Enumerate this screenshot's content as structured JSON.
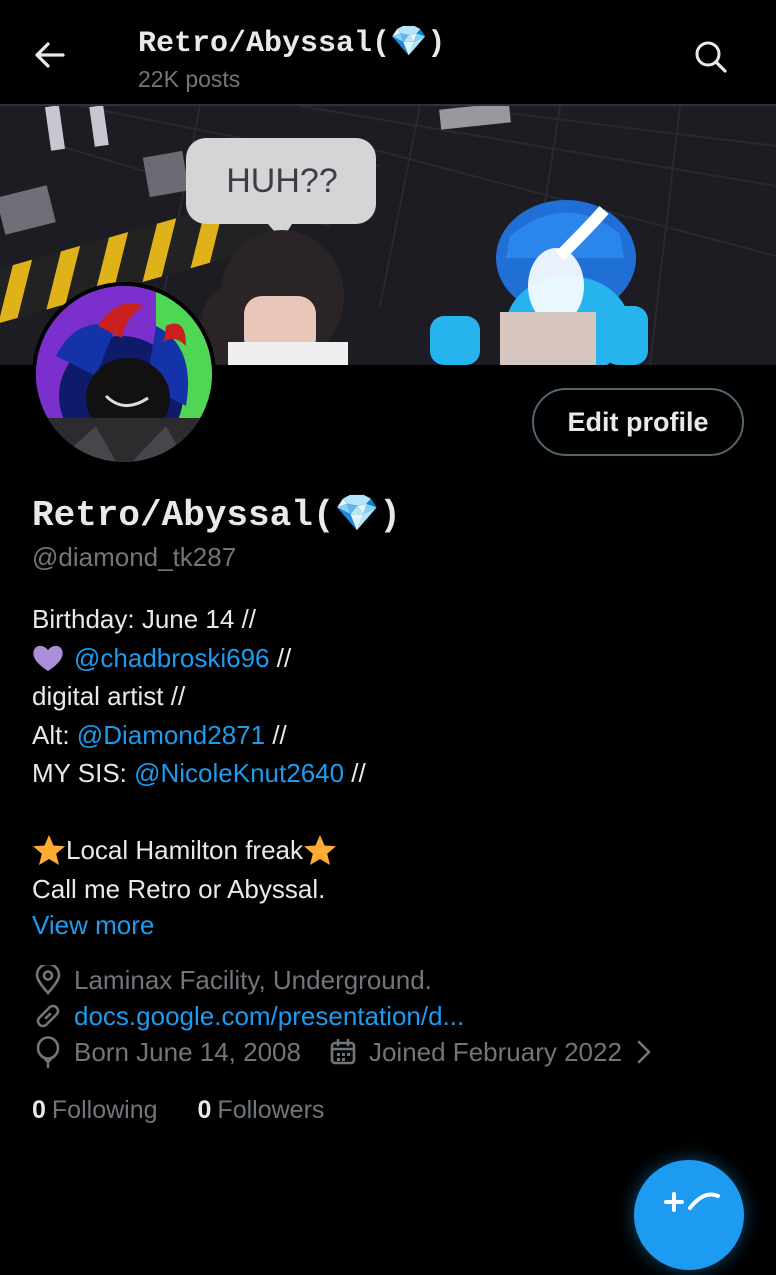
{
  "header": {
    "title": "Retro/Abyssal(💎)",
    "post_count": "22K posts",
    "back_icon": "arrow-left-icon",
    "search_icon": "search-icon"
  },
  "banner": {
    "speech_bubble_text": "HUH??"
  },
  "profile": {
    "edit_label": "Edit profile",
    "display_name": "Retro/Abyssal(💎)",
    "handle": "@diamond_tk287",
    "bio": {
      "line1_text": "Birthday: June 14 //",
      "line2_mention": "@chadbroski696",
      "line2_suffix": " //",
      "line3_text": "digital artist //",
      "line4_prefix": "Alt: ",
      "line4_mention": "@Diamond2871",
      "line4_suffix": " //",
      "line5_prefix": "MY SIS: ",
      "line5_mention": "@NicoleKnut2640",
      "line5_suffix": " //",
      "line7_text": "Local Hamilton freak",
      "line8_text": "Call me Retro or Abyssal."
    },
    "view_more": "View more",
    "location": "Laminax Facility, Underground.",
    "website": "docs.google.com/presentation/d...",
    "born": "Born June 14, 2008",
    "joined": "Joined February 2022",
    "following_count": "0",
    "following_label": "Following",
    "followers_count": "0",
    "followers_label": "Followers"
  },
  "colors": {
    "accent": "#1d9bf0",
    "muted": "#71767b",
    "text": "#e7e9ea",
    "heart": "#ac8fd8",
    "star": "#ffac33"
  }
}
